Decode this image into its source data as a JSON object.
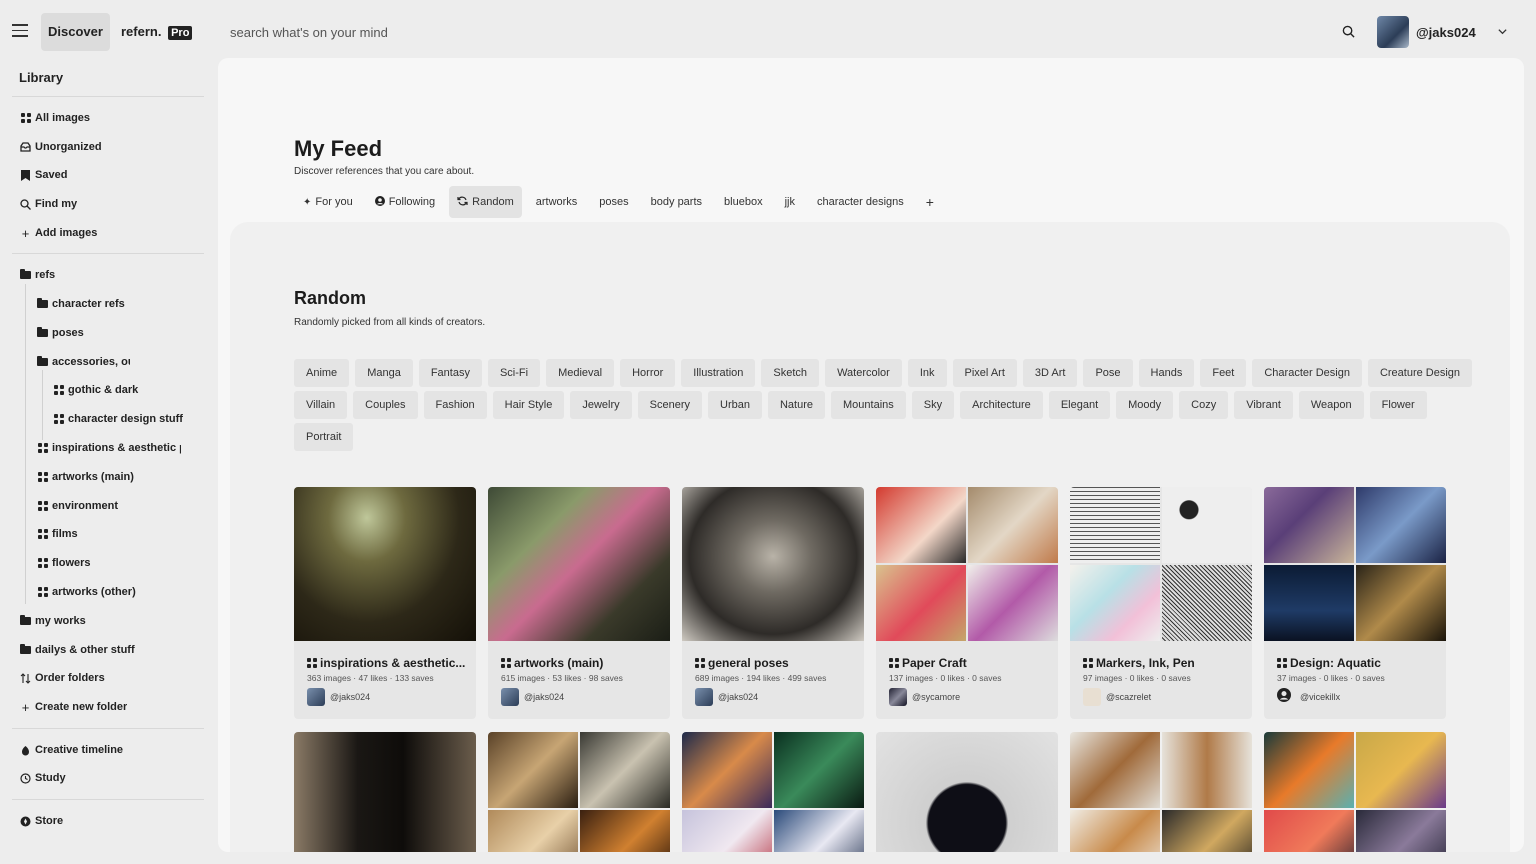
{
  "topbar": {
    "discover_label": "Discover",
    "brand": "refern.",
    "pro_badge": "Pro",
    "search_placeholder": "search what's on your mind",
    "username": "@jaks024"
  },
  "sidebar": {
    "library_title": "Library",
    "top_items": [
      {
        "label": "All images",
        "icon": "grid-icon"
      },
      {
        "label": "Unorganized",
        "icon": "inbox-icon"
      },
      {
        "label": "Saved",
        "icon": "bookmark-icon"
      },
      {
        "label": "Find my",
        "icon": "search-icon"
      },
      {
        "label": "Add images",
        "icon": "plus-icon"
      }
    ],
    "folders": [
      {
        "label": "refs",
        "icon": "folder-icon"
      },
      {
        "label": "character refs",
        "icon": "folder-icon"
      },
      {
        "label": "poses",
        "icon": "folder-icon"
      },
      {
        "label": "accessories, out",
        "icon": "folder-icon"
      },
      {
        "label": "gothic & dark",
        "icon": "grid-icon"
      },
      {
        "label": "character design stuff",
        "icon": "grid-icon"
      },
      {
        "label": "inspirations & aesthetic ph",
        "icon": "grid-icon"
      },
      {
        "label": "artworks (main)",
        "icon": "grid-icon"
      },
      {
        "label": "environment",
        "icon": "grid-icon"
      },
      {
        "label": "films",
        "icon": "grid-icon"
      },
      {
        "label": "flowers",
        "icon": "grid-icon"
      },
      {
        "label": "artworks (other)",
        "icon": "grid-icon"
      },
      {
        "label": "my works",
        "icon": "folder-icon"
      },
      {
        "label": "dailys & other stuff",
        "icon": "folder-icon"
      },
      {
        "label": "Order folders",
        "icon": "sort-icon"
      },
      {
        "label": "Create new folder",
        "icon": "plus-icon"
      }
    ],
    "bottom_items": [
      {
        "label": "Creative timeline",
        "icon": "timeline-icon"
      },
      {
        "label": "Study",
        "icon": "clock-icon"
      }
    ],
    "store_label": "Store"
  },
  "feed": {
    "title": "My Feed",
    "subtitle": "Discover references that you care about.",
    "tabs": [
      {
        "label": "For you",
        "icon": "sparkle-icon"
      },
      {
        "label": "Following",
        "icon": "user-circle-icon"
      },
      {
        "label": "Random",
        "icon": "refresh-icon",
        "active": true
      },
      {
        "label": "artworks"
      },
      {
        "label": "poses"
      },
      {
        "label": "body parts"
      },
      {
        "label": "bluebox"
      },
      {
        "label": "jjk"
      },
      {
        "label": "character designs"
      }
    ],
    "add_tab": "+"
  },
  "random": {
    "title": "Random",
    "subtitle": "Randomly picked from all kinds of creators.",
    "chips_row1": [
      "Anime",
      "Manga",
      "Fantasy",
      "Sci-Fi",
      "Medieval",
      "Horror",
      "Illustration",
      "Sketch",
      "Watercolor",
      "Ink",
      "Pixel Art",
      "3D Art",
      "Pose",
      "Hands",
      "Feet",
      "Character Design",
      "Creature Design"
    ],
    "chips_row2": [
      "Villain",
      "Couples",
      "Fashion",
      "Hair Style",
      "Jewelry",
      "Scenery",
      "Urban",
      "Nature",
      "Mountains",
      "Sky",
      "Architecture",
      "Elegant",
      "Moody",
      "Cozy",
      "Vibrant",
      "Weapon",
      "Flower"
    ],
    "chips_row3": [
      "Portrait"
    ]
  },
  "cards": [
    {
      "title": "inspirations & aesthetic...",
      "meta": "363 images · 47 likes · 133 saves",
      "owner": "@jaks024"
    },
    {
      "title": "artworks (main)",
      "meta": "615 images · 53 likes · 98 saves",
      "owner": "@jaks024"
    },
    {
      "title": "general poses",
      "meta": "689 images · 194 likes · 499 saves",
      "owner": "@jaks024"
    },
    {
      "title": "Paper Craft",
      "meta": "137 images · 0 likes · 0 saves",
      "owner": "@sycamore"
    },
    {
      "title": "Markers, Ink, Pen",
      "meta": "97 images · 0 likes · 0 saves",
      "owner": "@scazrelet"
    },
    {
      "title": "Design: Aquatic",
      "meta": "37 images · 0 likes · 0 saves",
      "owner": "@vicekillx"
    }
  ]
}
